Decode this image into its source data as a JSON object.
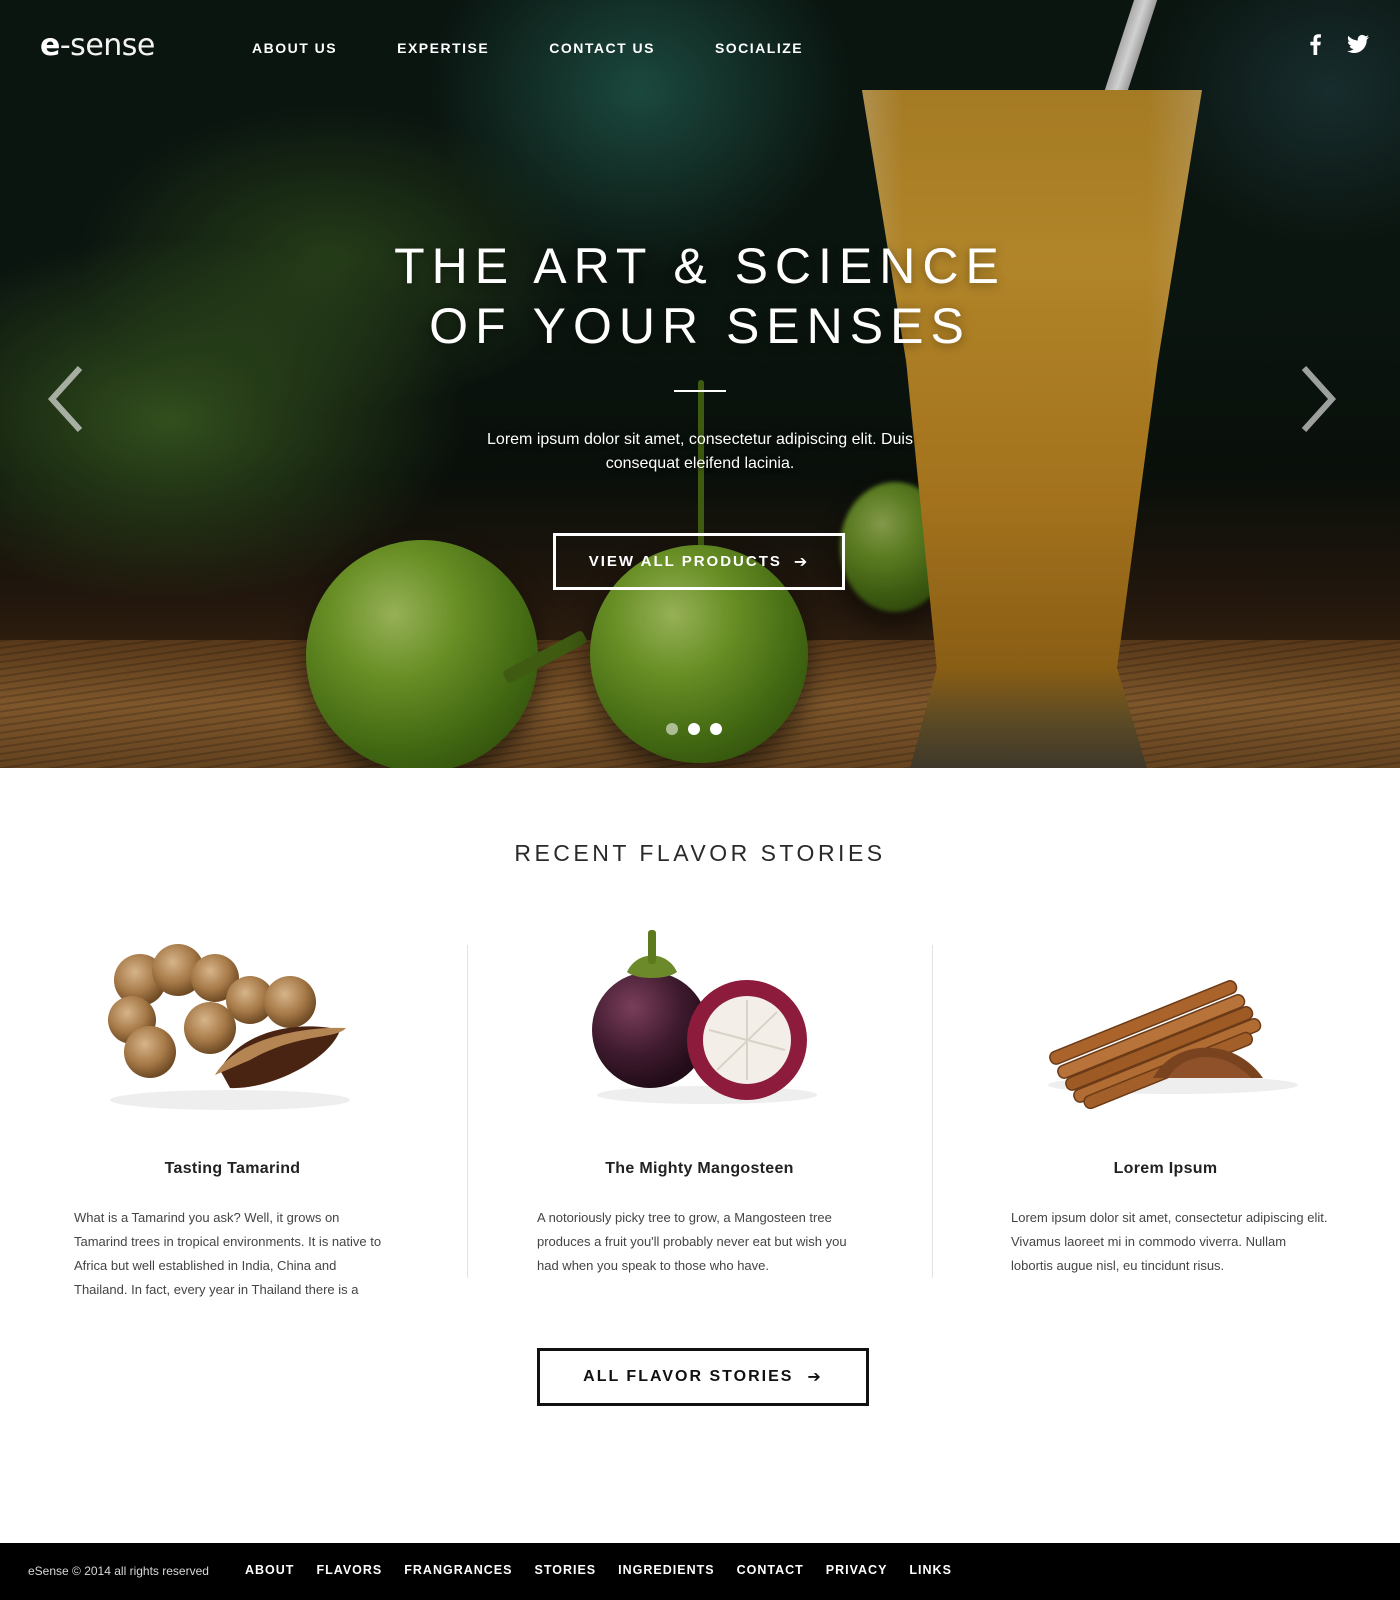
{
  "brand": {
    "logo_e": "e",
    "logo_rest": "-sense"
  },
  "nav": {
    "items": [
      {
        "label": "ABOUT US"
      },
      {
        "label": "EXPERTISE"
      },
      {
        "label": "CONTACT US"
      },
      {
        "label": "SOCIALIZE"
      }
    ],
    "social": [
      "facebook-icon",
      "twitter-icon"
    ]
  },
  "hero": {
    "title_line1": "THE ART & SCIENCE",
    "title_line2": "OF YOUR SENSES",
    "subtitle": "Lorem ipsum dolor sit amet, consectetur adipiscing elit. Duis consequat eleifend lacinia.",
    "button_label": "VIEW ALL PRODUCTS",
    "button_icon": "arrow-right-icon",
    "slides_total": 3,
    "active_slide": 3
  },
  "stories": {
    "heading": "RECENT FLAVOR STORIES",
    "items": [
      {
        "title": "Tasting Tamarind",
        "text": "What is a Tamarind you ask? Well, it grows on Tamarind trees in tropical environments. It is native to Africa but well established in India, China and Thailand. In fact, every year in Thailand there is a",
        "image": "tamarind-image"
      },
      {
        "title": "The Mighty Mangosteen",
        "text": "A notoriously picky tree to grow, a Mangosteen tree produces a fruit you'll probably never eat but wish you had when you speak to those who have.",
        "image": "mangosteen-image"
      },
      {
        "title": "Lorem Ipsum",
        "text": "Lorem ipsum dolor sit amet, consectetur adipiscing elit. Vivamus laoreet mi in commodo viverra. Nullam lobortis augue nisl, eu tincidunt risus.",
        "image": "cinnamon-image"
      }
    ],
    "button_label": "ALL FLAVOR STORIES"
  },
  "footer": {
    "copyright": "eSense © 2014 all rights reserved",
    "links": [
      {
        "label": "ABOUT"
      },
      {
        "label": "FLAVORS"
      },
      {
        "label": "FRANGRANCES"
      },
      {
        "label": "STORIES"
      },
      {
        "label": "INGREDIENTS"
      },
      {
        "label": "CONTACT"
      },
      {
        "label": "PRIVACY"
      },
      {
        "label": "LINKS"
      }
    ]
  },
  "colors": {
    "accent": "#ffffff",
    "footer_bg": "#000000",
    "text": "#222222"
  }
}
